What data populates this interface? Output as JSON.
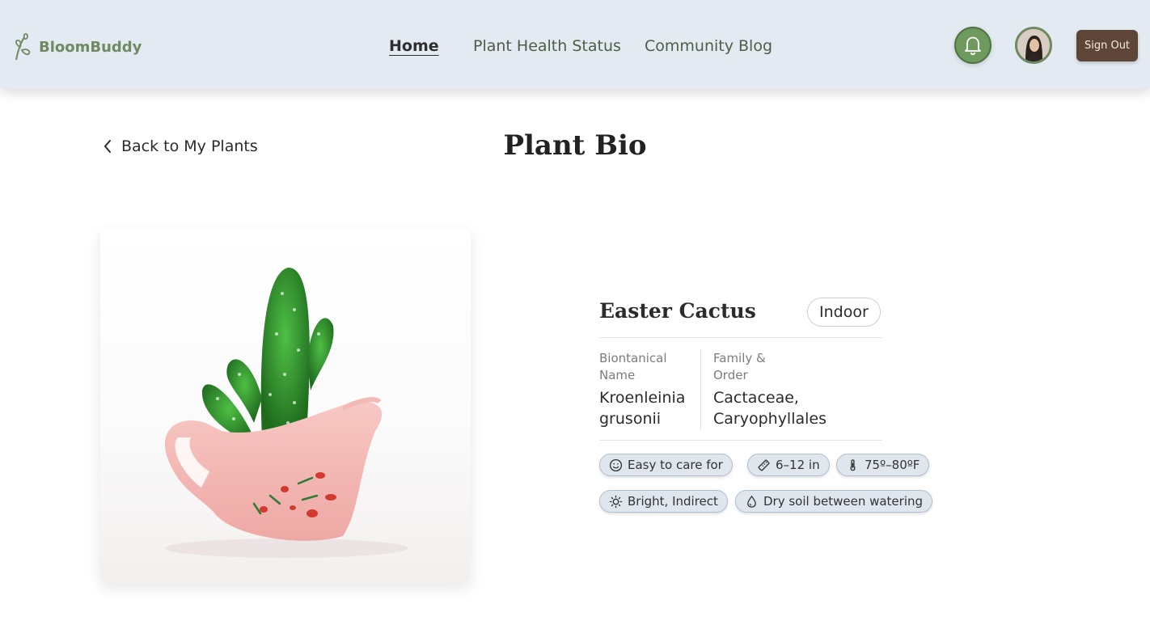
{
  "brand": {
    "name": "BloomBuddy",
    "color": "#6f8a62"
  },
  "nav": {
    "items": [
      {
        "label": "Home",
        "active": true
      },
      {
        "label": "Plant Health Status",
        "active": false
      },
      {
        "label": "Community Blog",
        "active": false
      }
    ]
  },
  "header": {
    "sign_out_label": "Sign Out",
    "notification_icon": "bell-icon",
    "avatar_icon": "user-avatar"
  },
  "page": {
    "back_label": "Back to My Plants",
    "title": "Plant Bio"
  },
  "plant": {
    "name": "Easter Cactus",
    "location_tag": "Indoor",
    "botanical_label_line1": "Biontanical",
    "botanical_label_line2": "Name",
    "botanical_value_line1": "Kroenleinia",
    "botanical_value_line2": "grusonii",
    "family_label_line1": "Family &",
    "family_label_line2": "Order",
    "family_value_line1": "Cactaceae,",
    "family_value_line2": "Caryophyllales",
    "care_chips": [
      {
        "label": "Easy to care for",
        "icon": "smile-icon"
      },
      {
        "label": "6–12 in",
        "icon": "ruler-icon"
      },
      {
        "label": "75º–80ºF",
        "icon": "thermometer-icon"
      },
      {
        "label": "Bright, Indirect",
        "icon": "sun-icon"
      },
      {
        "label": "Dry soil between watering",
        "icon": "droplet-icon"
      }
    ]
  },
  "colors": {
    "header_bg": "#e3eaf2",
    "accent_green": "#6f9a5f",
    "signout_bg": "#5d4638",
    "chip_bg": "#dfe6ee"
  }
}
